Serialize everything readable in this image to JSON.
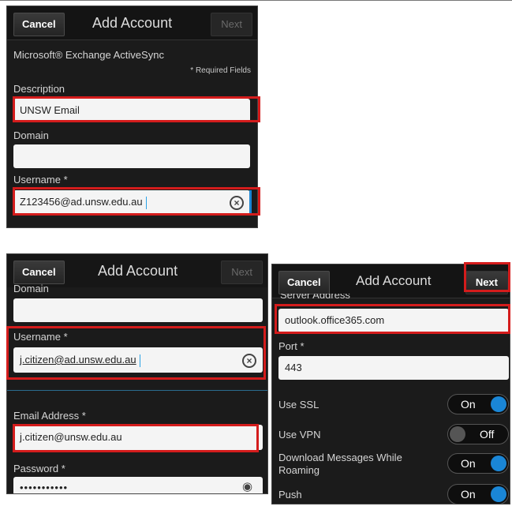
{
  "panel1": {
    "cancel": "Cancel",
    "title": "Add Account",
    "next": "Next",
    "account_type": "Microsoft® Exchange ActiveSync",
    "required_note": "* Required Fields",
    "description_label": "Description",
    "description_value": "UNSW Email",
    "domain_label": "Domain",
    "domain_value": "",
    "username_label": "Username *",
    "username_value": "Z123456@ad.unsw.edu.au"
  },
  "panel2": {
    "cancel": "Cancel",
    "title": "Add Account",
    "next": "Next",
    "domain_label": "Domain",
    "domain_value": "",
    "username_label": "Username *",
    "username_value": "j.citizen@ad.unsw.edu.au",
    "email_label": "Email Address *",
    "email_value": "j.citizen@unsw.edu.au",
    "password_label": "Password *",
    "password_value": "•••••••••••"
  },
  "panel3": {
    "cancel": "Cancel",
    "title": "Add Account",
    "next": "Next",
    "server_label": "Server Address",
    "server_value": "outlook.office365.com",
    "port_label": "Port *",
    "port_value": "443",
    "settings": [
      {
        "label": "Use SSL",
        "state": "On"
      },
      {
        "label": "Use VPN",
        "state": "Off"
      },
      {
        "label": "Download Messages While Roaming",
        "state": "On"
      },
      {
        "label": "Push",
        "state": "On"
      }
    ]
  },
  "colors": {
    "highlight": "#d41c1c",
    "toggle_on": "#1a86d6"
  }
}
